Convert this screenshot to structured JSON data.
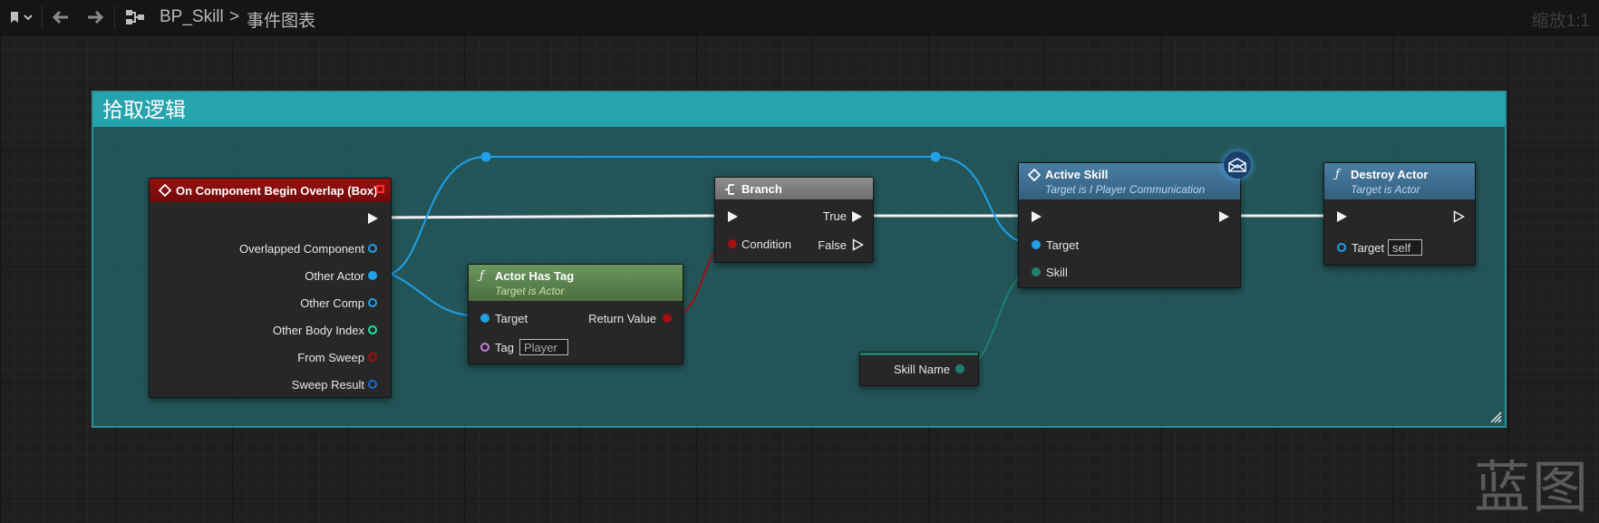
{
  "toolbar": {
    "title": "BP_Skill",
    "separator": ">",
    "graph_name": "事件图表",
    "zoom": "缩放1:1"
  },
  "comment": {
    "title": "拾取逻辑"
  },
  "nodes": {
    "overlap": {
      "title": "On Component Begin Overlap (Box)",
      "pins": [
        "Overlapped Component",
        "Other Actor",
        "Other Comp",
        "Other Body Index",
        "From Sweep",
        "Sweep Result"
      ]
    },
    "actor_has_tag": {
      "title": "Actor Has Tag",
      "subtitle": "Target is Actor",
      "target_label": "Target",
      "tag_label": "Tag",
      "tag_value": "Player",
      "return_label": "Return Value"
    },
    "branch": {
      "title": "Branch",
      "condition_label": "Condition",
      "true_label": "True",
      "false_label": "False"
    },
    "active_skill": {
      "title": "Active Skill",
      "subtitle": "Target is I Player Communication",
      "target_label": "Target",
      "skill_label": "Skill"
    },
    "destroy_actor": {
      "title": "Destroy Actor",
      "subtitle": "Target is Actor",
      "target_label": "Target",
      "target_value": "self"
    },
    "skill_name": {
      "label": "Skill Name"
    }
  },
  "colors": {
    "exec": "#f2f2f2",
    "object_pin": "#1fa0e8",
    "bool_pin": "#a50f0f",
    "name_pin": "#1f7f6e",
    "comment_header": "#27a3ad",
    "event_header": "#8b0d0d",
    "function_header": "#5f8a53",
    "message_header": "#3f6e8d"
  },
  "watermark": "蓝图"
}
